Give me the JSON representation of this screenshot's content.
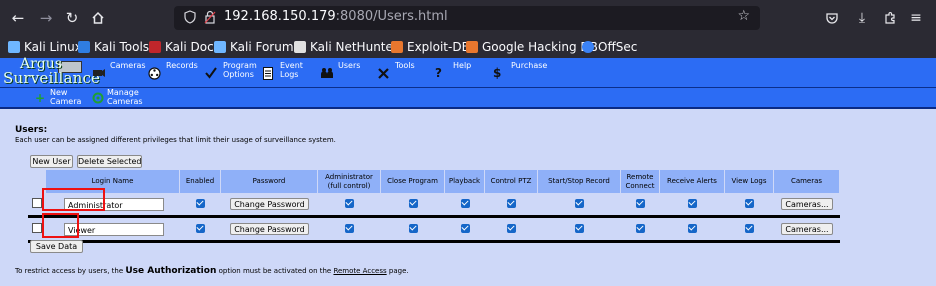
{
  "browser": {
    "url_host": "192.168.150.179",
    "url_rest": ":8080/Users.html",
    "bookmarks": [
      "Kali Linux",
      "Kali Tools",
      "Kali Docs",
      "Kali Forums",
      "Kali NetHunter",
      "Exploit-DB",
      "Google Hacking DB",
      "OffSec"
    ]
  },
  "app": {
    "logo_top": "Argus",
    "logo_bottom": "Surveillance"
  },
  "menu": {
    "items": [
      {
        "label": "Cameras",
        "icon": "camera-icon"
      },
      {
        "label": "Records",
        "icon": "film-reel-icon"
      },
      {
        "label": "Program\nOptions",
        "icon": "checkmark-icon"
      },
      {
        "label": "Event\nLogs",
        "icon": "document-icon"
      },
      {
        "label": "Users",
        "icon": "users-icon"
      },
      {
        "label": "Tools",
        "icon": "tools-icon"
      },
      {
        "label": "Help",
        "icon": "question-icon"
      },
      {
        "label": "Purchase",
        "icon": "dollar-icon"
      }
    ]
  },
  "submenu": {
    "items": [
      {
        "label": "New\nCamera",
        "icon": "add-camera-icon"
      },
      {
        "label": "Manage\nCameras",
        "icon": "manage-cameras-icon"
      }
    ]
  },
  "users_section": {
    "heading": "Users:",
    "description": "Each user can be assigned different privileges that limit their usage of surveillance system.",
    "new_user_label": "New User",
    "delete_selected_label": "Delete Selected",
    "save_data_label": "Save Data"
  },
  "table": {
    "headers": [
      "Login Name",
      "Enabled",
      "Password",
      "Administrator\n(full control)",
      "Close Program",
      "Playback",
      "Control  PTZ",
      "Start/Stop Record",
      "Remote\nConnect",
      "Receive Alerts",
      "View Logs",
      "Cameras"
    ],
    "rows": [
      {
        "login": "Administrator",
        "password_btn": "Change Password",
        "cameras_btn": "Cameras...",
        "selected": false,
        "enabled": true,
        "admin": true,
        "close_program": true,
        "playback": true,
        "control_ptz": true,
        "start_stop_record": true,
        "remote_connect": true,
        "receive_alerts": true,
        "view_logs": true
      },
      {
        "login": "Viewer",
        "password_btn": "Change Password",
        "cameras_btn": "Cameras...",
        "selected": false,
        "enabled": true,
        "admin": true,
        "close_program": true,
        "playback": true,
        "control_ptz": true,
        "start_stop_record": true,
        "remote_connect": true,
        "receive_alerts": true,
        "view_logs": true
      }
    ]
  },
  "footer": {
    "part1": "To restrict access by users, the",
    "emphasis": "Use Authorization",
    "part2": "option must be activated on the",
    "link": "Remote Access",
    "part3": "page."
  },
  "colors": {
    "menu_bg": "#2c6cf4",
    "page_bg": "#ced8f8",
    "header_bg": "#8fb0f8",
    "highlight": "#ee1111"
  }
}
